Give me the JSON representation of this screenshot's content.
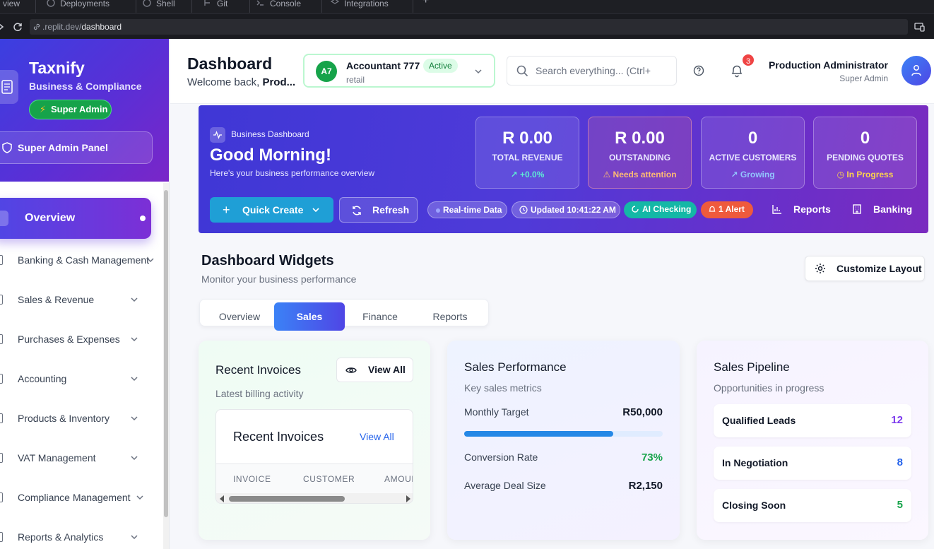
{
  "browser": {
    "tabs": [
      "view",
      "Deployments",
      "Shell",
      "Git",
      "Console",
      "Integrations"
    ],
    "url_host": ".replit.dev/",
    "url_path": "dashboard"
  },
  "sidebar": {
    "brand": "Taxnify",
    "brand_sub": "Business & Compliance",
    "role_badge": "Super Admin",
    "panel_button": "Super Admin Panel",
    "active_item": "Overview",
    "items": [
      {
        "label": "Banking & Cash Management"
      },
      {
        "label": "Sales & Revenue"
      },
      {
        "label": "Purchases & Expenses"
      },
      {
        "label": "Accounting"
      },
      {
        "label": "Products & Inventory"
      },
      {
        "label": "VAT Management"
      },
      {
        "label": "Compliance Management"
      },
      {
        "label": "Reports & Analytics"
      }
    ]
  },
  "header": {
    "title": "Dashboard",
    "welcome_prefix": "Welcome back, ",
    "welcome_name": "Prod...",
    "account": {
      "initials": "A7",
      "name": "Accountant 777",
      "status": "Active",
      "type": "retail"
    },
    "search_placeholder": "Search everything... (Ctrl+",
    "notification_count": "3",
    "user_name": "Production Administrator",
    "user_role": "Super Admin"
  },
  "hero": {
    "kicker": "Business Dashboard",
    "title": "Good Morning!",
    "subtitle": "Here's your business performance overview",
    "stats": [
      {
        "value": "R 0.00",
        "label": "TOTAL REVENUE",
        "trend": "↗ +0.0%",
        "trend_color": "#5eead4"
      },
      {
        "value": "R 0.00",
        "label": "OUTSTANDING",
        "trend": "⚠ Needs attention",
        "trend_color": "#fdba74"
      },
      {
        "value": "0",
        "label": "ACTIVE CUSTOMERS",
        "trend": "↗ Growing",
        "trend_color": "#93c5fd"
      },
      {
        "value": "0",
        "label": "PENDING QUOTES",
        "trend": "◷ In Progress",
        "trend_color": "#fcd34d"
      }
    ],
    "quick_create": "Quick Create",
    "refresh": "Refresh",
    "pill_realtime": "Real-time Data",
    "pill_updated": "Updated 10:41:22 AM",
    "pill_ai": "AI Checking",
    "pill_alert": "1 Alert",
    "link_reports": "Reports",
    "link_banking": "Banking"
  },
  "widgets": {
    "title": "Dashboard Widgets",
    "subtitle": "Monitor your business performance",
    "customize": "Customize Layout",
    "tabs": [
      "Overview",
      "Sales",
      "Finance",
      "Reports"
    ],
    "active_tab": "Sales"
  },
  "invoices": {
    "title": "Recent Invoices",
    "subtitle": "Latest billing activity",
    "view_all": "View All",
    "inner_title": "Recent Invoices",
    "inner_link": "View All",
    "columns": [
      "INVOICE",
      "CUSTOMER",
      "AMOUNT"
    ]
  },
  "performance": {
    "title": "Sales Performance",
    "subtitle": "Key sales metrics",
    "target_label": "Monthly Target",
    "target_value": "R50,000",
    "target_progress": 0.75,
    "conversion_label": "Conversion Rate",
    "conversion_value": "73%",
    "deal_label": "Average Deal Size",
    "deal_value": "R2,150"
  },
  "pipeline": {
    "title": "Sales Pipeline",
    "subtitle": "Opportunities in progress",
    "rows": [
      {
        "label": "Qualified Leads",
        "value": "12",
        "color": "#7c3aed"
      },
      {
        "label": "In Negotiation",
        "value": "8",
        "color": "#2563eb"
      },
      {
        "label": "Closing Soon",
        "value": "5",
        "color": "#16a34a"
      }
    ]
  }
}
